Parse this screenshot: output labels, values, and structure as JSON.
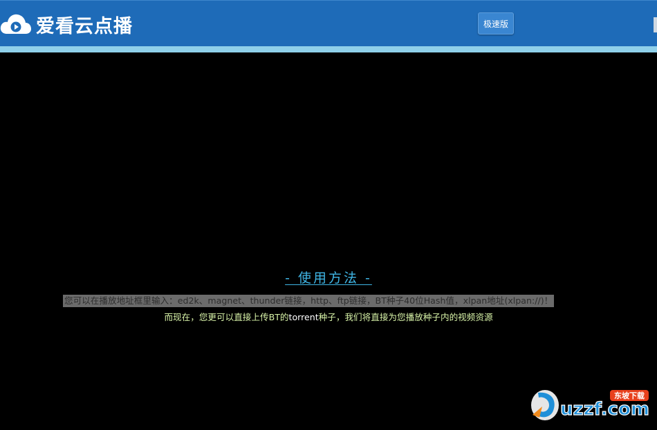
{
  "header": {
    "app_title": "爱看云点播",
    "speed_button_label": "极速版",
    "brand_color": "#1e6bb8",
    "accent_color": "#8fd0ea"
  },
  "player": {
    "usage_title": "- 使用方法 -",
    "usage_line1": "您可以在播放地址框里输入：ed2k、magnet、thunder链接，http、ftp链接，BT种子40位Hash值，xlpan地址(xlpan://)！",
    "usage_line2_part1": "而现在，您更可以直接上传BT的",
    "usage_line2_highlight": "torrent",
    "usage_line2_part2": "种子，我们将直接为您播放种子内的视频资源"
  },
  "watermark": {
    "text": "uzzf.com",
    "tag": "东坡下载"
  },
  "icons": {
    "logo": "cloud-play-icon",
    "watermark": "uzzf-logo-icon"
  }
}
